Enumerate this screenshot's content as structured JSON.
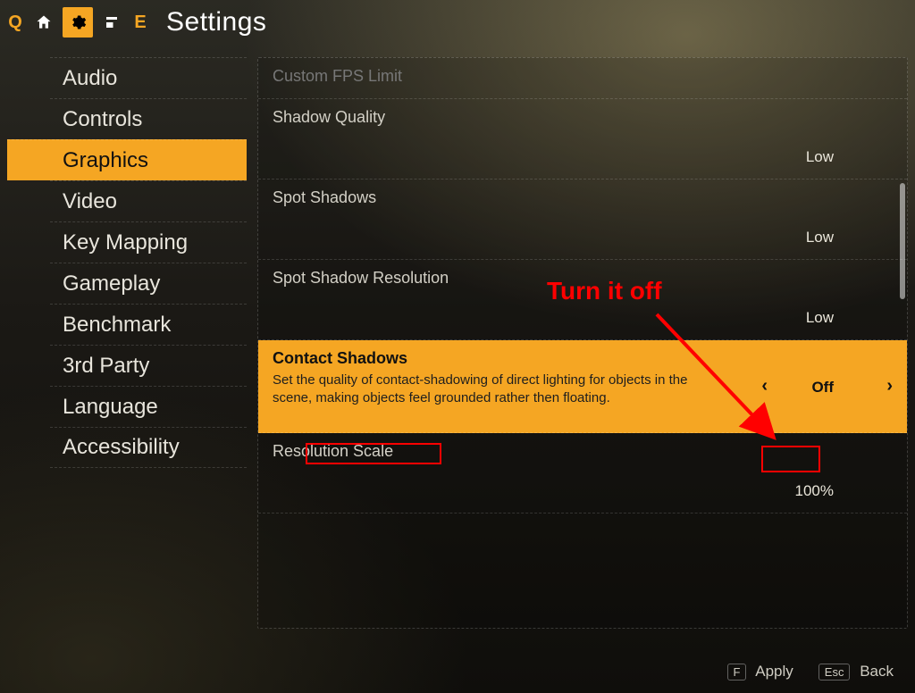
{
  "topbar": {
    "left_hint": "Q",
    "right_hint": "E",
    "title": "Settings"
  },
  "sidebar": {
    "items": [
      {
        "label": "Audio",
        "active": false
      },
      {
        "label": "Controls",
        "active": false
      },
      {
        "label": "Graphics",
        "active": true
      },
      {
        "label": "Video",
        "active": false
      },
      {
        "label": "Key Mapping",
        "active": false
      },
      {
        "label": "Gameplay",
        "active": false
      },
      {
        "label": "Benchmark",
        "active": false
      },
      {
        "label": "3rd Party",
        "active": false
      },
      {
        "label": "Language",
        "active": false
      },
      {
        "label": "Accessibility",
        "active": false
      }
    ]
  },
  "settings": [
    {
      "label": "Custom FPS Limit",
      "value": "",
      "dim": true
    },
    {
      "label": "Shadow Quality",
      "value": "Low"
    },
    {
      "label": "Spot Shadows",
      "value": "Low"
    },
    {
      "label": "Spot Shadow Resolution",
      "value": "Low"
    },
    {
      "label": "Contact Shadows",
      "value": "Off",
      "selected": true,
      "desc": "Set the quality of contact-shadowing of direct lighting for objects in the scene, making objects feel grounded rather then floating."
    },
    {
      "label": "Resolution Scale",
      "value": "100%"
    }
  ],
  "footer": {
    "apply": {
      "key": "F",
      "label": "Apply"
    },
    "back": {
      "key": "Esc",
      "label": "Back"
    }
  },
  "annotation": {
    "text": "Turn it off"
  }
}
